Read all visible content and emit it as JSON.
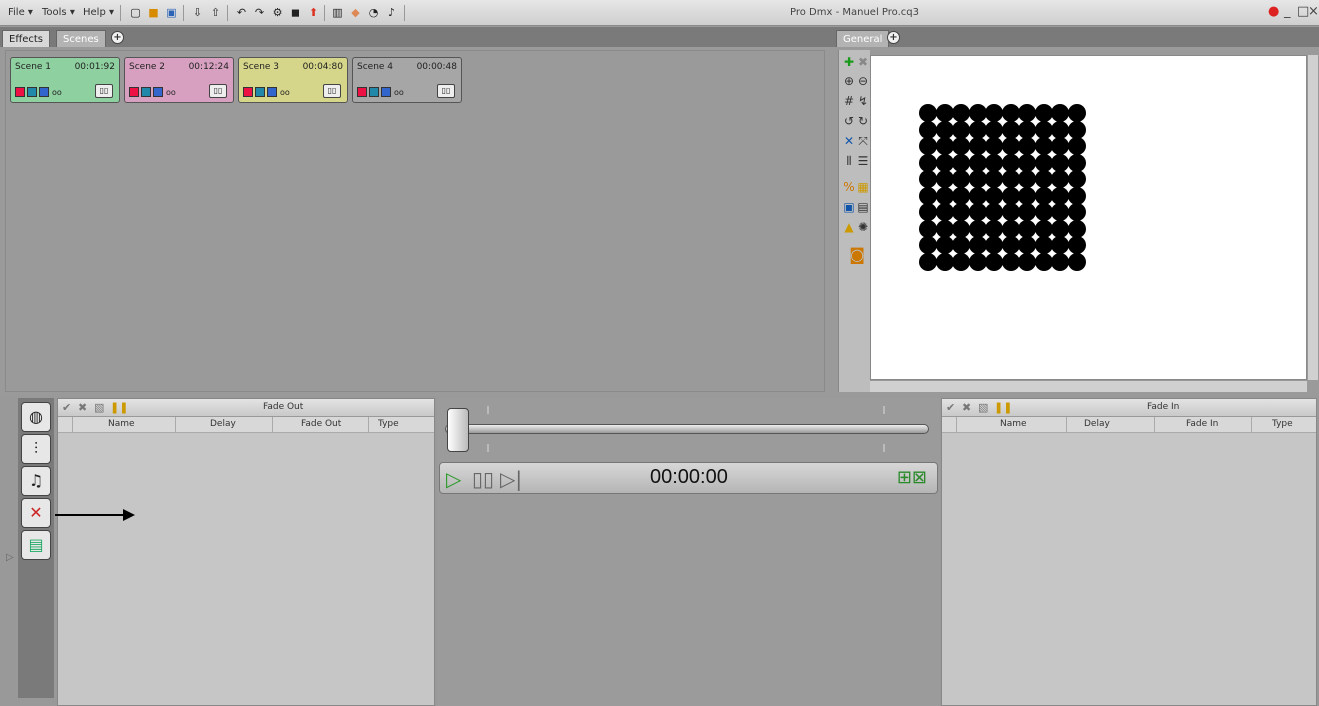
{
  "menu": {
    "file": "File ▾",
    "tools": "Tools ▾",
    "help": "Help ▾"
  },
  "app_title": "Pro Dmx - Manuel Pro.cq3",
  "left_tabs": {
    "effects": "Effects",
    "scenes": "Scenes",
    "add": "+"
  },
  "right_tabs": {
    "general": "General",
    "add": "+"
  },
  "scenes": [
    {
      "name": "Scene 1",
      "time": "00:01:92",
      "suffix": "oo",
      "color": "#8fd0a0"
    },
    {
      "name": "Scene 2",
      "time": "00:12:24",
      "suffix": "oo",
      "color": "#d7a0c0"
    },
    {
      "name": "Scene 3",
      "time": "00:04:80",
      "suffix": "oo",
      "color": "#d6d68a"
    },
    {
      "name": "Scene 4",
      "time": "00:00:48",
      "suffix": "oo",
      "color": "#a6a6a6"
    }
  ],
  "fade_out": {
    "title": "Fade Out",
    "columns": [
      "Name",
      "Delay",
      "Fade Out",
      "Type"
    ]
  },
  "fade_in": {
    "title": "Fade In",
    "columns": [
      "Name",
      "Delay",
      "Fade In",
      "Type"
    ]
  },
  "transport": {
    "timecode": "00:00:00"
  },
  "icons": {
    "color_wheel": "color-wheel-icon",
    "mixer": "mixer-icon",
    "audio": "audio-icon",
    "crossfade": "crossfade-icon",
    "timeline": "timeline-icon"
  }
}
